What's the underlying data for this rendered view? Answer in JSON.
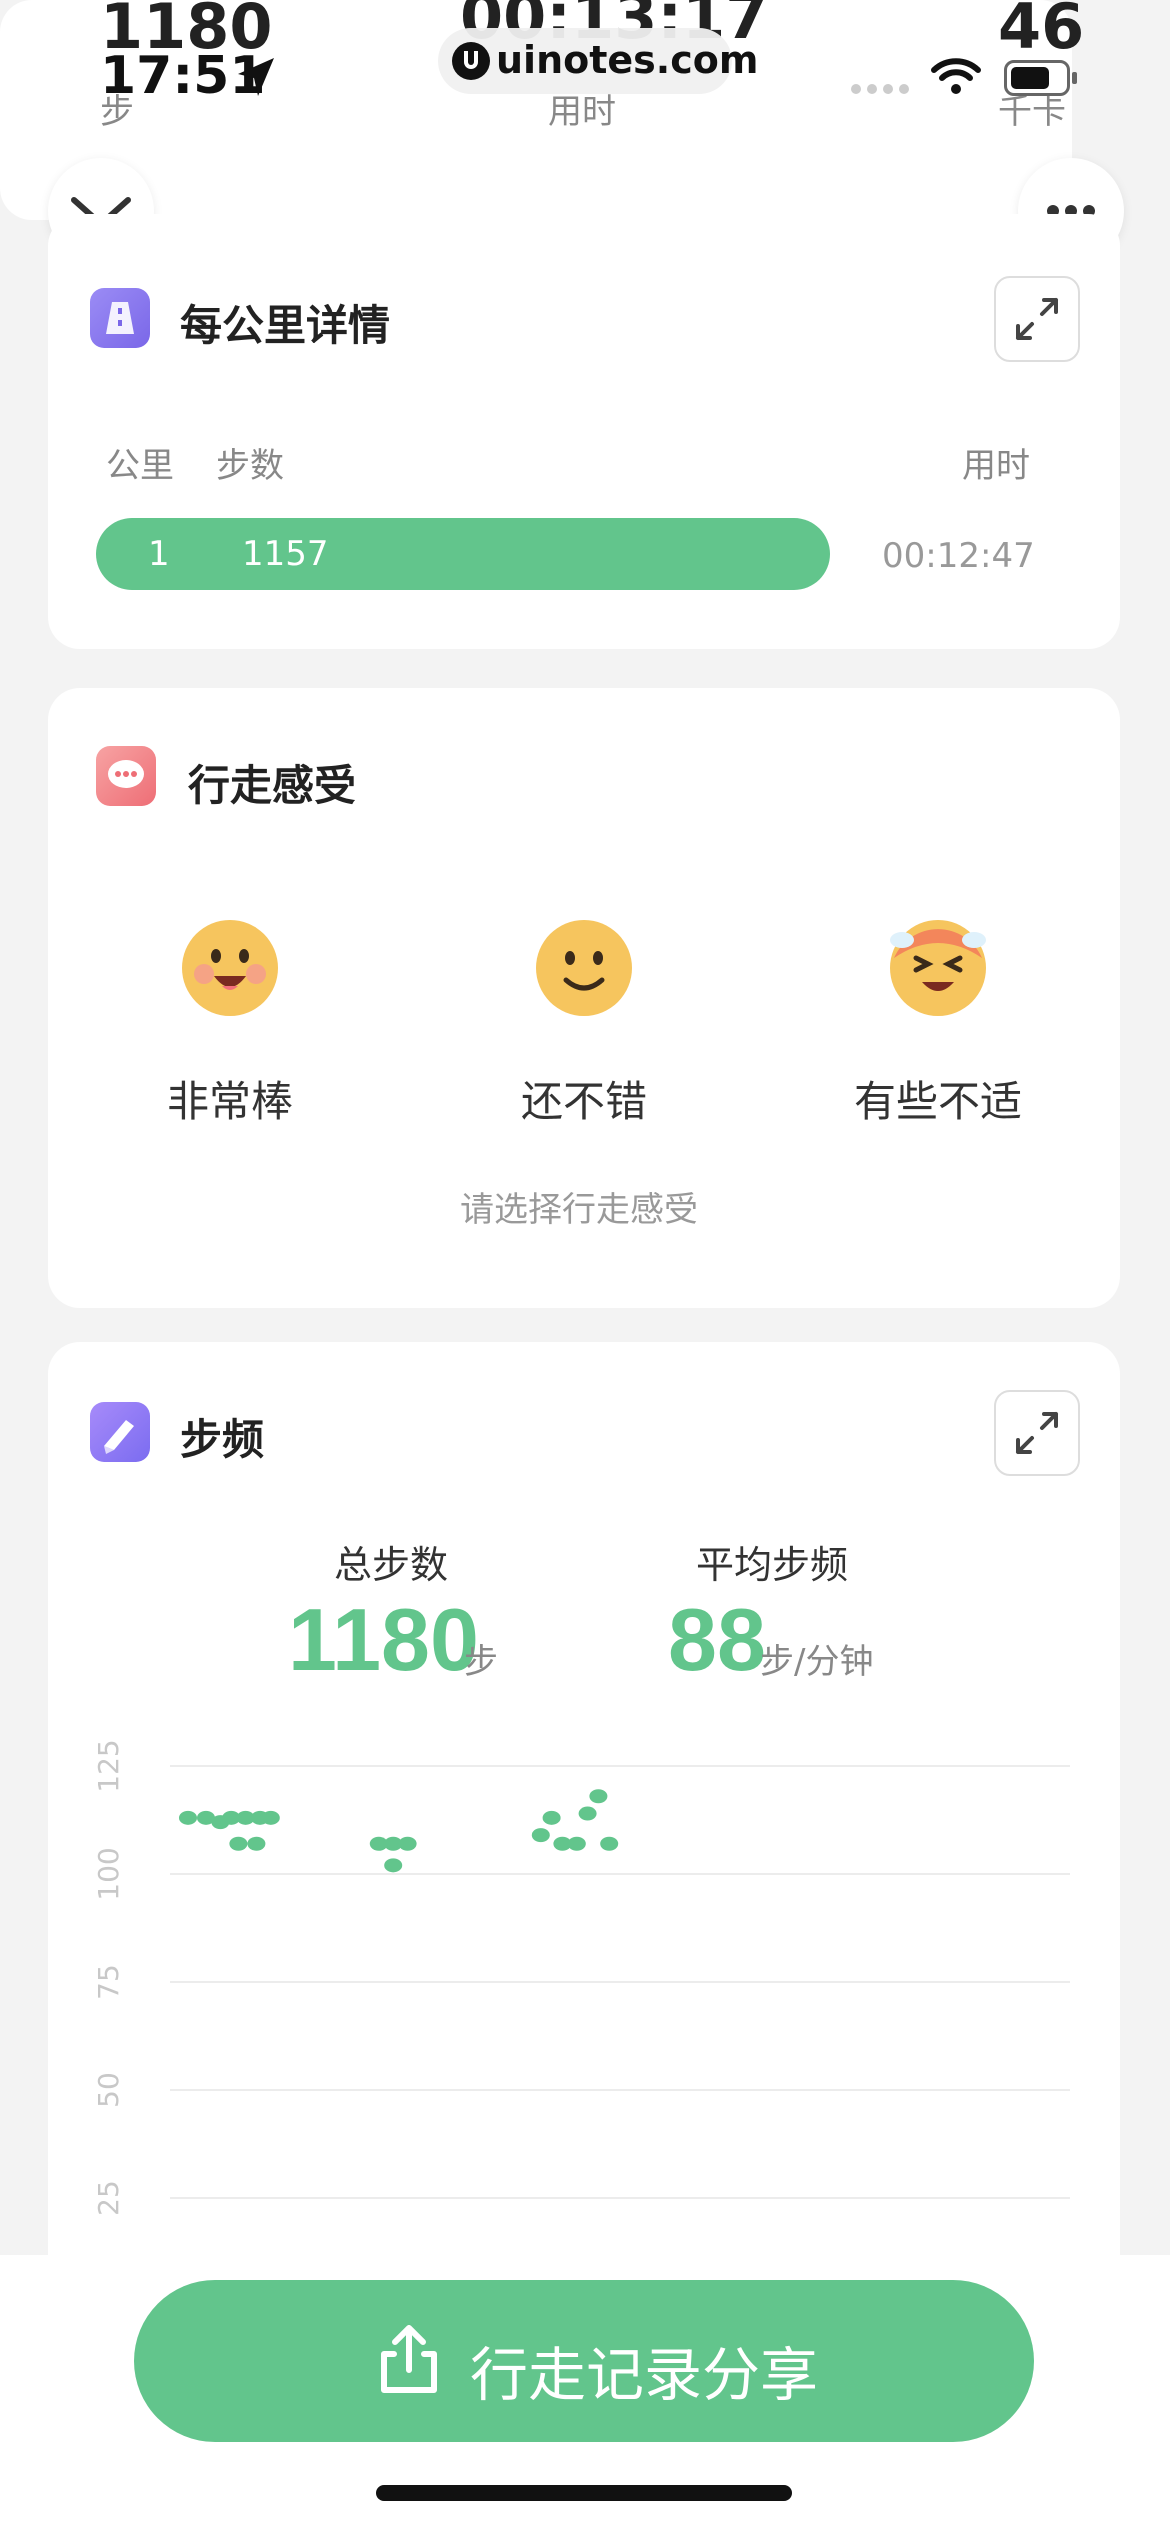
{
  "status_bar": {
    "time": "17:51",
    "url": "uinotes.com"
  },
  "summary": {
    "steps_value": "1180",
    "steps_unit": "步",
    "duration_value": "00:13:17",
    "duration_label": "用时",
    "calories_value": "46",
    "calories_unit": "千卡"
  },
  "km_details": {
    "title": "每公里详情",
    "col_km": "公里",
    "col_steps": "步数",
    "col_time": "用时",
    "rows": [
      {
        "km": "1",
        "steps": "1157",
        "time": "00:12:47"
      }
    ]
  },
  "walk_feeling": {
    "title": "行走感受",
    "options": [
      "非常棒",
      "还不错",
      "有些不适"
    ],
    "hint": "请选择行走感受"
  },
  "cadence": {
    "title": "步频",
    "total_steps_label": "总步数",
    "total_steps_value": "1180",
    "total_steps_unit": "步",
    "avg_label": "平均步频",
    "avg_value": "88",
    "avg_unit": "步/分钟"
  },
  "chart_data": {
    "type": "scatter",
    "y_ticks": [
      "125",
      "100",
      "75",
      "50",
      "25"
    ],
    "ylim": [
      0,
      125
    ],
    "points": [
      [
        0.5,
        113
      ],
      [
        1.0,
        113
      ],
      [
        1.4,
        112
      ],
      [
        1.7,
        113
      ],
      [
        2.1,
        113
      ],
      [
        2.5,
        113
      ],
      [
        2.8,
        113
      ],
      [
        1.9,
        107
      ],
      [
        2.4,
        107
      ],
      [
        5.8,
        107
      ],
      [
        6.2,
        107
      ],
      [
        6.6,
        107
      ],
      [
        6.2,
        102
      ],
      [
        10.3,
        109
      ],
      [
        10.6,
        113
      ],
      [
        10.9,
        107
      ],
      [
        11.3,
        107
      ],
      [
        11.6,
        114
      ],
      [
        11.9,
        118
      ],
      [
        12.2,
        107
      ]
    ],
    "color": "#62c58c"
  },
  "share": {
    "label": "行走记录分享"
  }
}
